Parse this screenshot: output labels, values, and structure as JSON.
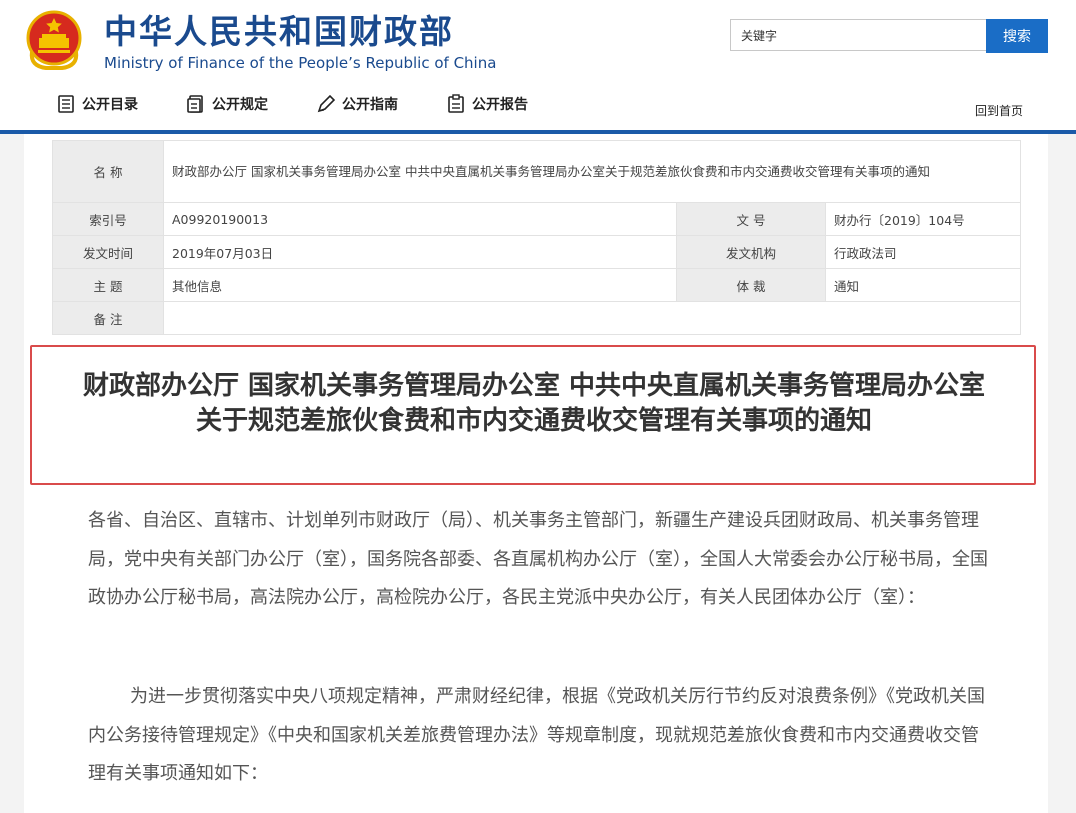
{
  "header": {
    "title": "中华人民共和国财政部",
    "subtitle": "Ministry of Finance of the People’s Republic of China",
    "search": {
      "value": "关键字",
      "button_label": "搜索"
    },
    "nav": [
      {
        "label": "公开目录",
        "icon": "catalog-icon"
      },
      {
        "label": "公开规定",
        "icon": "regulation-icon"
      },
      {
        "label": "公开指南",
        "icon": "guide-pen-icon"
      },
      {
        "label": "公开报告",
        "icon": "report-icon"
      }
    ],
    "home_link": "回到首页",
    "accent_color": "#1a5aa8"
  },
  "meta": {
    "name_label": "名  称",
    "name_value": "财政部办公厅 国家机关事务管理局办公室 中共中央直属机关事务管理局办公室关于规范差旅伙食费和市内交通费收交管理有关事项的通知",
    "index_label": "索引号",
    "index_value": "A09920190013",
    "docno_label": "文  号",
    "docno_value": "财办行〔2019〕104号",
    "date_label": "发文时间",
    "date_value": "2019年07月03日",
    "org_label": "发文机构",
    "org_value": "行政政法司",
    "topic_label": "主  题",
    "topic_value": "其他信息",
    "genre_label": "体  裁",
    "genre_value": "通知",
    "remark_label": "备  注",
    "remark_value": ""
  },
  "document": {
    "title": "财政部办公厅 国家机关事务管理局办公室 中共中央直属机关事务管理局办公室关于规范差旅伙食费和市内交通费收交管理有关事项的通知",
    "highlight_color": "#d94b4b",
    "paragraphs": [
      "各省、自治区、直辖市、计划单列市财政厅（局）、机关事务主管部门，新疆生产建设兵团财政局、机关事务管理局，党中央有关部门办公厅（室），国务院各部委、各直属机构办公厅（室），全国人大常委会办公厅秘书局，全国政协办公厅秘书局，高法院办公厅，高检院办公厅，各民主党派中央办公厅，有关人民团体办公厅（室）：",
      "为进一步贯彻落实中央八项规定精神，严肃财经纪律，根据《党政机关厉行节约反对浪费条例》《党政机关国内公务接待管理规定》《中央和国家机关差旅费管理办法》等规章制度，现就规范差旅伙食费和市内交通费收交管理有关事项通知如下："
    ]
  }
}
